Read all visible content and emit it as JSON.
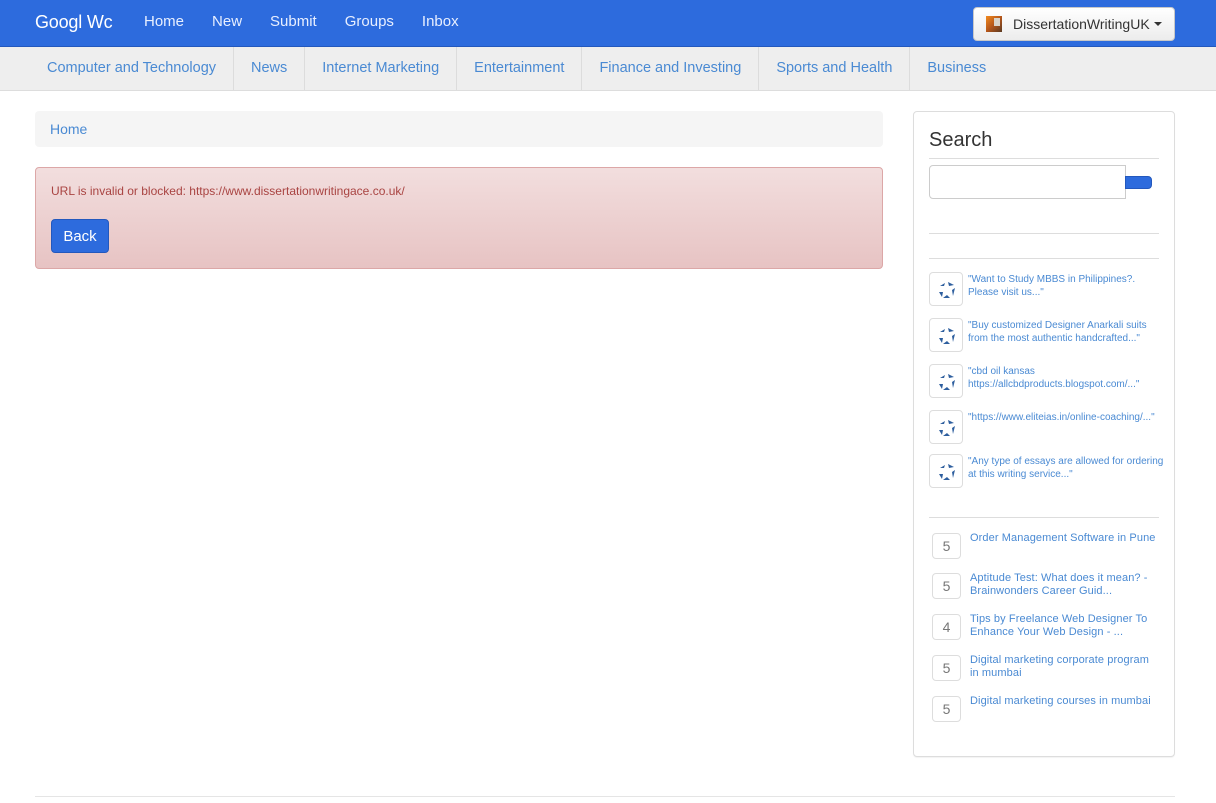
{
  "navbar": {
    "brand": "Googl Wc",
    "links": [
      "Home",
      "New",
      "Submit",
      "Groups",
      "Inbox"
    ],
    "user": "DissertationWritingUK",
    "accent": "#2d6bdd"
  },
  "categories": [
    "Computer and Technology",
    "News",
    "Internet Marketing",
    "Entertainment",
    "Finance and Investing",
    "Sports and Health",
    "Business"
  ],
  "breadcrumb": {
    "home": "Home"
  },
  "alert": {
    "message": "URL is invalid or blocked: https://www.dissertationwritingace.co.uk/",
    "button": "Back"
  },
  "sidebar": {
    "search_title": "Search",
    "search_value": "",
    "comments": [
      "\"Want to Study MBBS in Philippines?. Please visit us...\"",
      "\"Buy customized Designer Anarkali suits from the most authentic handcrafted...\"",
      "\"cbd oil kansas https://allcbdproducts.blogspot.com/...\"",
      "\"https://www.eliteias.in/online-coaching/...\"",
      "\"Any type of essays are allowed for ordering at this writing service...\""
    ],
    "top_stories": [
      {
        "score": "5",
        "title": "Order Management Software in Pune"
      },
      {
        "score": "5",
        "title": "Aptitude Test: What does it mean? - Brainwonders Career Guid..."
      },
      {
        "score": "4",
        "title": "Tips by Freelance Web Designer To Enhance Your Web Design - ..."
      },
      {
        "score": "5",
        "title": "Digital marketing corporate program in mumbai"
      },
      {
        "score": "5",
        "title": "Digital marketing courses in mumbai"
      }
    ]
  }
}
